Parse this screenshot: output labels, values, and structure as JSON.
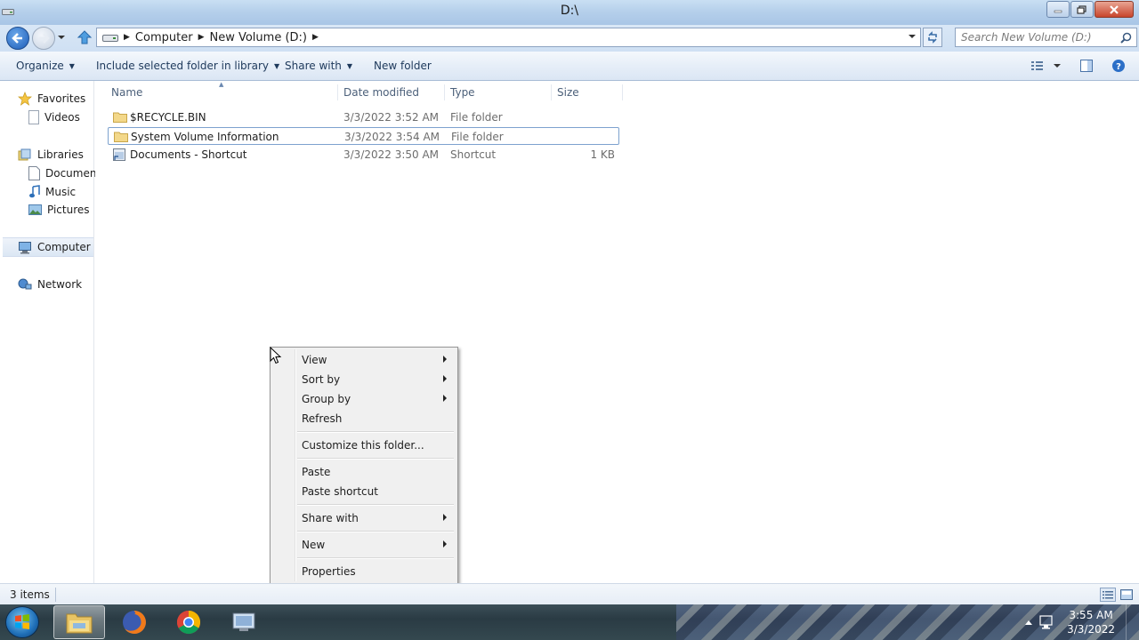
{
  "window": {
    "title": "D:\\"
  },
  "address": {
    "crumbs": [
      "Computer",
      "New Volume (D:)"
    ],
    "search_placeholder": "Search New Volume (D:)"
  },
  "toolbar": {
    "organize": "Organize",
    "include": "Include selected folder in library",
    "share": "Share with",
    "new_folder": "New folder"
  },
  "nav": {
    "favorites": "Favorites",
    "videos": "Videos",
    "libraries": "Libraries",
    "documents": "Document",
    "music": "Music",
    "pictures": "Pictures",
    "computer": "Computer",
    "network": "Network"
  },
  "columns": {
    "name": "Name",
    "date": "Date modified",
    "type": "Type",
    "size": "Size"
  },
  "files": [
    {
      "name": "$RECYCLE.BIN",
      "date": "3/3/2022 3:52 AM",
      "type": "File folder",
      "size": ""
    },
    {
      "name": "System Volume Information",
      "date": "3/3/2022 3:54 AM",
      "type": "File folder",
      "size": ""
    },
    {
      "name": "Documents - Shortcut",
      "date": "3/3/2022 3:50 AM",
      "type": "Shortcut",
      "size": "1 KB"
    }
  ],
  "status": {
    "count": "3 items"
  },
  "context_menu": {
    "view": "View",
    "sort_by": "Sort by",
    "group_by": "Group by",
    "refresh": "Refresh",
    "customize": "Customize this folder...",
    "paste": "Paste",
    "paste_shortcut": "Paste shortcut",
    "share_with": "Share with",
    "new": "New",
    "properties": "Properties"
  },
  "taskbar": {
    "time": "3:55 AM",
    "date": "3/3/2022"
  },
  "colors": {
    "accent": "#1e395b",
    "selection_border": "#7da2ce"
  }
}
